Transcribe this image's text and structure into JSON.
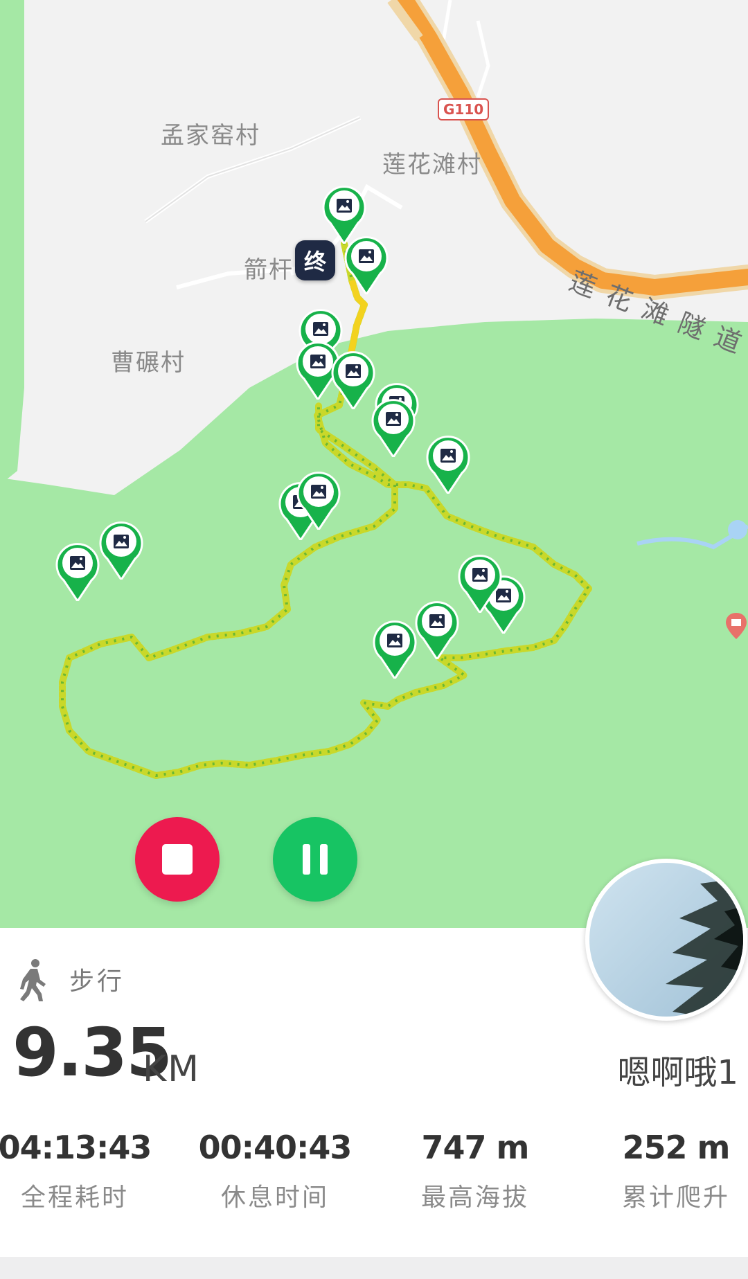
{
  "map": {
    "villages": [
      "孟家窑村",
      "莲花滩村",
      "箭杆",
      "曹碾村"
    ],
    "road_shield": "G110",
    "tunnel_label": "莲花滩隧道",
    "end_marker": "终",
    "photo_marker_count": 16
  },
  "controls": {
    "stop": "stop",
    "pause": "pause"
  },
  "activity": {
    "type": "步行",
    "distance_value": "9.35",
    "distance_unit": "KM"
  },
  "user": {
    "name": "嗯啊哦1"
  },
  "stats": [
    {
      "value": "04:13:43",
      "label": "全程耗时"
    },
    {
      "value": "00:40:43",
      "label": "休息时间"
    },
    {
      "value": "747 m",
      "label": "最高海拔"
    },
    {
      "value": "252 m",
      "label": "累计爬升"
    }
  ],
  "colors": {
    "map_bg": "#f2f2f2",
    "forest": "#a5e8a5",
    "highway": "#f5a03a",
    "stop_button": "#ed1a4f",
    "pause_button": "#17c463",
    "marker_green": "#17b24a",
    "end_marker_bg": "#1f2a44"
  }
}
